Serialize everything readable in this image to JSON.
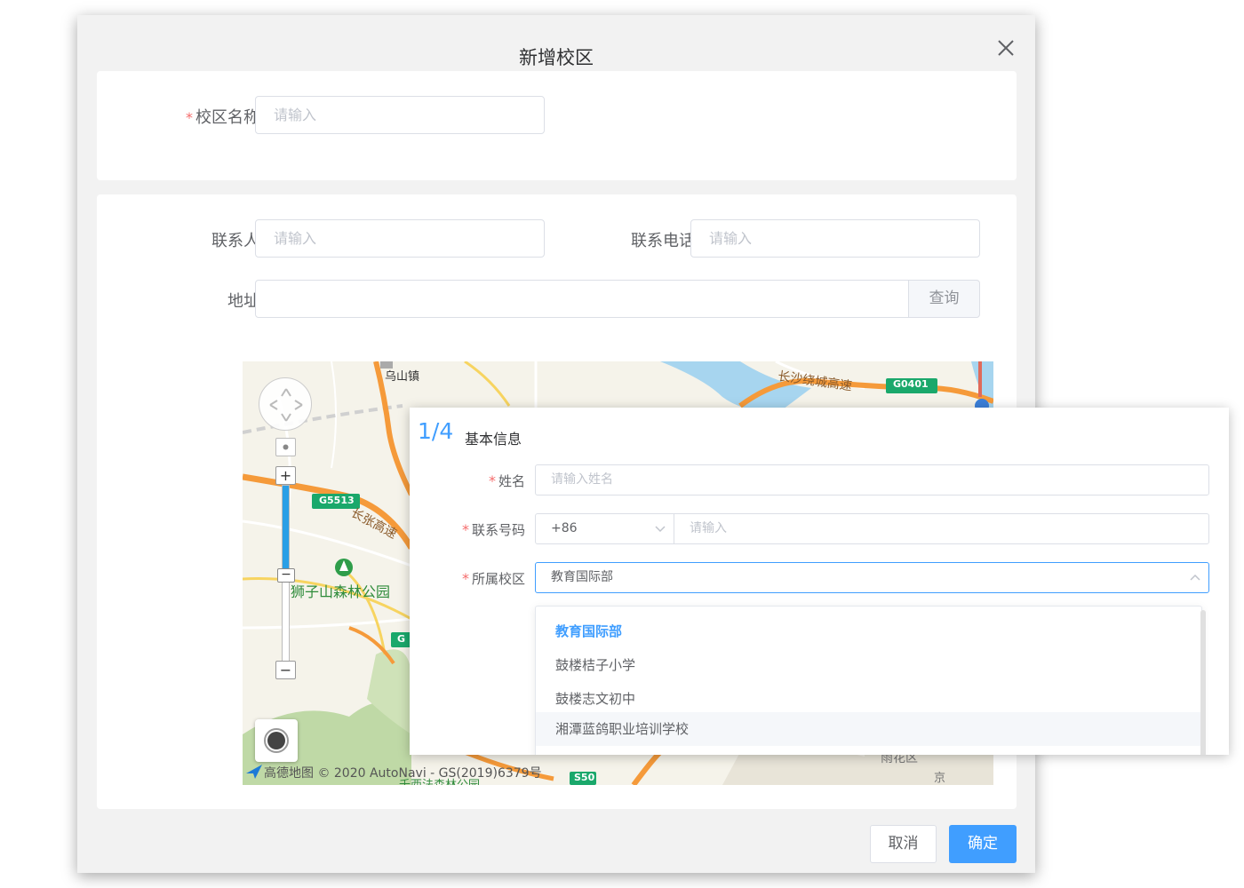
{
  "dialog": {
    "title": "新增校区",
    "close_icon": "close-icon"
  },
  "basic": {
    "campus_name_label": "校区名称",
    "campus_name_placeholder": "请输入"
  },
  "contact": {
    "contact_person_label": "联系人",
    "contact_person_placeholder": "请输入",
    "phone_label": "联系电话",
    "phone_placeholder": "请输入",
    "address_label": "地址",
    "address_value": "",
    "query_button": "查询"
  },
  "map": {
    "labels": {
      "wushan": "乌山镇",
      "changsha_ring": "长沙绕城高速",
      "g0401": "G0401",
      "g5513": "G5513",
      "changzhang": "长张高速",
      "park": "狮子山森林公园",
      "g_partial": "G",
      "s50": "S50",
      "yuhua": "雨花区",
      "jing": "京",
      "lower_park": "千西法森林公园"
    },
    "attribution": "高德地图 © 2020 AutoNavi - GS(2019)6379号",
    "controls": {
      "pan_icon": "pan-compass-icon",
      "zoom_in": "+",
      "zoom_out": "−",
      "zoom_level_fraction": 0.25,
      "locate_icon": "locate-icon"
    }
  },
  "member_form": {
    "step": "1/4",
    "step_title": "基本信息",
    "name_label": "姓名",
    "name_placeholder": "请输入姓名",
    "phone_label": "联系号码",
    "country_code": "+86",
    "phone_placeholder": "请输入",
    "campus_label": "所属校区",
    "campus_value": "教育国际部",
    "campus_options": [
      "教育国际部",
      "鼓楼桔子小学",
      "鼓楼志文初中",
      "湘潭蓝鸽职业培训学校"
    ]
  },
  "footer": {
    "cancel": "取消",
    "confirm": "确定"
  },
  "colors": {
    "primary": "#409eff",
    "required": "#f56c6c",
    "highway_green": "#1aa86b",
    "road_orange": "#f59a3a"
  }
}
